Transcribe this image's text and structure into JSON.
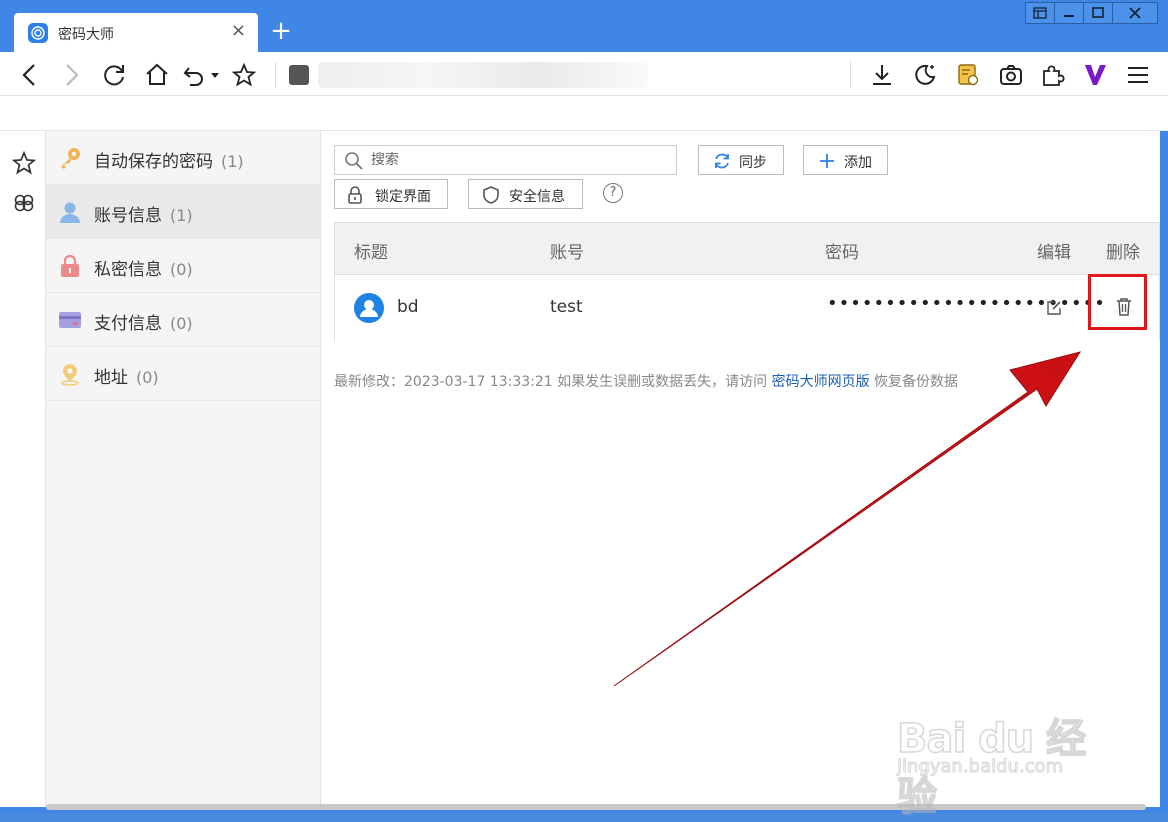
{
  "browser": {
    "tab_title": "密码大师",
    "tab_close": "×",
    "new_tab": "+"
  },
  "sidebar": {
    "items": [
      {
        "label": "自动保存的密码",
        "count": "(1)",
        "icon": "key-icon",
        "active": false
      },
      {
        "label": "账号信息",
        "count": "(1)",
        "icon": "user-icon",
        "active": true
      },
      {
        "label": "私密信息",
        "count": "(0)",
        "icon": "lock-icon",
        "active": false
      },
      {
        "label": "支付信息",
        "count": "(0)",
        "icon": "card-icon",
        "active": false
      },
      {
        "label": "地址",
        "count": "(0)",
        "icon": "location-icon",
        "active": false
      }
    ]
  },
  "main": {
    "search_placeholder": "搜索",
    "sync_label": "同步",
    "add_label": "添加",
    "lock_label": "锁定界面",
    "security_label": "安全信息",
    "help": "?",
    "table": {
      "headers": [
        "标题",
        "账号",
        "密码",
        "编辑",
        "删除"
      ],
      "rows": [
        {
          "title": "bd",
          "account": "test",
          "password": "••••••••••••••••••••••••"
        }
      ]
    },
    "footer": {
      "prefix": "最新修改：2023-03-17 13:33:21 如果发生误删或数据丢失，请访问",
      "link": "密码大师网页版",
      "suffix": "恢复备份数据"
    }
  },
  "watermark": {
    "line1": "Bai du 经验",
    "line2": "jingyan.baidu.com"
  },
  "colors": {
    "accent": "#3f86e6",
    "highlight": "#e0161b",
    "link": "#1a5fb4"
  }
}
